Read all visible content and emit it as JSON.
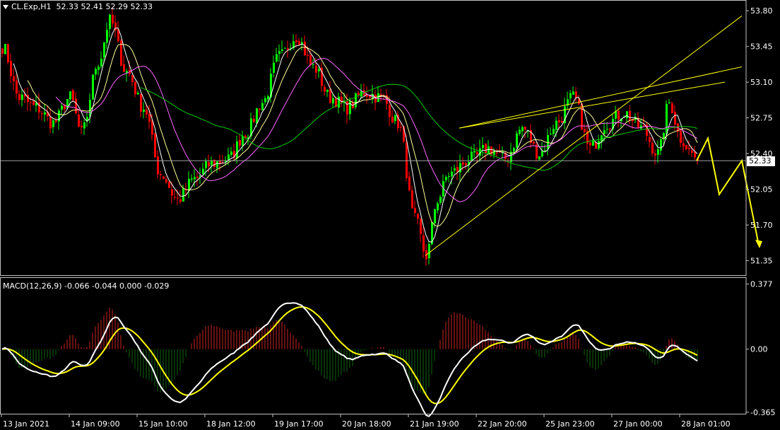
{
  "header": {
    "symbol": "CL.Exp,H1",
    "ohlc": "52.33 52.41 52.29 52.33",
    "macd_label": "MACD(12,26,9) -0.066 -0.044 0.000 -0.029"
  },
  "current_price": "52.33",
  "colors": {
    "background": "#000000",
    "up_candle": "#00ff00",
    "down_candle": "#ff0000",
    "ma_fast": "#ffffff",
    "ma_mid": "#ffff99",
    "ma_slow": "#ff66ff",
    "ma_long": "#00cc00",
    "trendline": "#ffff00",
    "arrow": "#ffff00",
    "macd_line": "#ffffff",
    "signal_line": "#ffff00",
    "hist_pos": "#cc2222",
    "hist_neg": "#116611"
  },
  "chart_data": [
    {
      "type": "candlestick",
      "title": "CL.Exp,H1",
      "y_ticks": [
        "53.80",
        "53.45",
        "53.10",
        "52.75",
        "52.40",
        "52.05",
        "51.70",
        "51.35"
      ],
      "ylim": [
        51.25,
        53.85
      ],
      "x_ticks": [
        "13 Jan 2021",
        "14 Jan 09:00",
        "15 Jan 10:00",
        "18 Jan 12:00",
        "19 Jan 17:00",
        "20 Jan 18:00",
        "21 Jan 19:00",
        "22 Jan 20:00",
        "25 Jan 23:00",
        "27 Jan 00:00",
        "28 Jan 01:00"
      ],
      "close_anchors": [
        [
          0,
          53.45
        ],
        [
          6,
          52.95
        ],
        [
          12,
          52.85
        ],
        [
          18,
          52.7
        ],
        [
          24,
          52.95
        ],
        [
          28,
          52.6
        ],
        [
          34,
          53.3
        ],
        [
          38,
          53.7
        ],
        [
          44,
          53.2
        ],
        [
          50,
          52.85
        ],
        [
          56,
          52.2
        ],
        [
          62,
          51.95
        ],
        [
          68,
          52.15
        ],
        [
          74,
          52.3
        ],
        [
          80,
          52.35
        ],
        [
          86,
          52.6
        ],
        [
          92,
          52.9
        ],
        [
          98,
          53.35
        ],
        [
          104,
          53.55
        ],
        [
          110,
          53.25
        ],
        [
          116,
          52.95
        ],
        [
          122,
          52.85
        ],
        [
          128,
          53.0
        ],
        [
          134,
          52.95
        ],
        [
          140,
          52.7
        ],
        [
          146,
          51.75
        ],
        [
          150,
          51.4
        ],
        [
          154,
          51.95
        ],
        [
          158,
          52.2
        ],
        [
          166,
          52.35
        ],
        [
          172,
          52.45
        ],
        [
          178,
          52.35
        ],
        [
          184,
          52.65
        ],
        [
          190,
          52.4
        ],
        [
          196,
          52.7
        ],
        [
          202,
          52.95
        ],
        [
          208,
          52.45
        ],
        [
          214,
          52.7
        ],
        [
          220,
          52.8
        ],
        [
          226,
          52.65
        ],
        [
          232,
          52.4
        ],
        [
          236,
          52.9
        ],
        [
          240,
          52.55
        ],
        [
          244,
          52.4
        ],
        [
          246,
          52.33
        ]
      ],
      "moving_averages": [
        {
          "name": "fast",
          "period": 5
        },
        {
          "name": "mid",
          "period": 10
        },
        {
          "name": "slow",
          "period": 20
        },
        {
          "name": "long",
          "period": 50
        }
      ],
      "trendlines": [
        {
          "from": [
            150,
            51.4
          ],
          "to": [
            262,
            53.75
          ]
        },
        {
          "from": [
            162,
            52.65
          ],
          "to": [
            262,
            53.25
          ]
        },
        {
          "from": [
            162,
            52.65
          ],
          "to": [
            256,
            53.1
          ]
        }
      ],
      "projection_arrow": [
        [
          246,
          52.33
        ],
        [
          250,
          52.55
        ],
        [
          254,
          52.0
        ],
        [
          262,
          52.33
        ],
        [
          268,
          51.5
        ]
      ]
    },
    {
      "type": "macd",
      "parameters": [
        12,
        26,
        9
      ],
      "values": {
        "main": -0.066,
        "signal": -0.044,
        "zero": 0.0,
        "histogram": -0.029
      },
      "y_ticks": [
        "0.377",
        "0.00",
        "-0.365"
      ],
      "ylim": [
        -0.37,
        0.4
      ]
    }
  ]
}
